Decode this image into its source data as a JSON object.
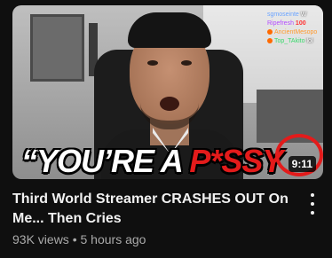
{
  "video": {
    "title": "Third World Streamer CRASHES OUT On Me... Then Cries",
    "views": "93K views",
    "separator": "•",
    "age": "5 hours ago",
    "duration": "9:11"
  },
  "thumbnail": {
    "caption_white": "“YOU’RE A",
    "caption_red": "P*SSY",
    "chat": [
      {
        "user": "sgmoseinte",
        "msg": "W"
      },
      {
        "user": "Ripefresh",
        "msg": "100"
      },
      {
        "user": "AncientMesopo",
        "msg": ""
      },
      {
        "user": "Top_TAkito",
        "msg": "lol"
      }
    ]
  },
  "colors": {
    "background": "#0f0f0f",
    "title_text": "#f1f1f1",
    "meta_text": "#aaaaaa",
    "accent_red": "#e31b1b"
  },
  "icons": {
    "menu": "more-vertical-icon"
  }
}
